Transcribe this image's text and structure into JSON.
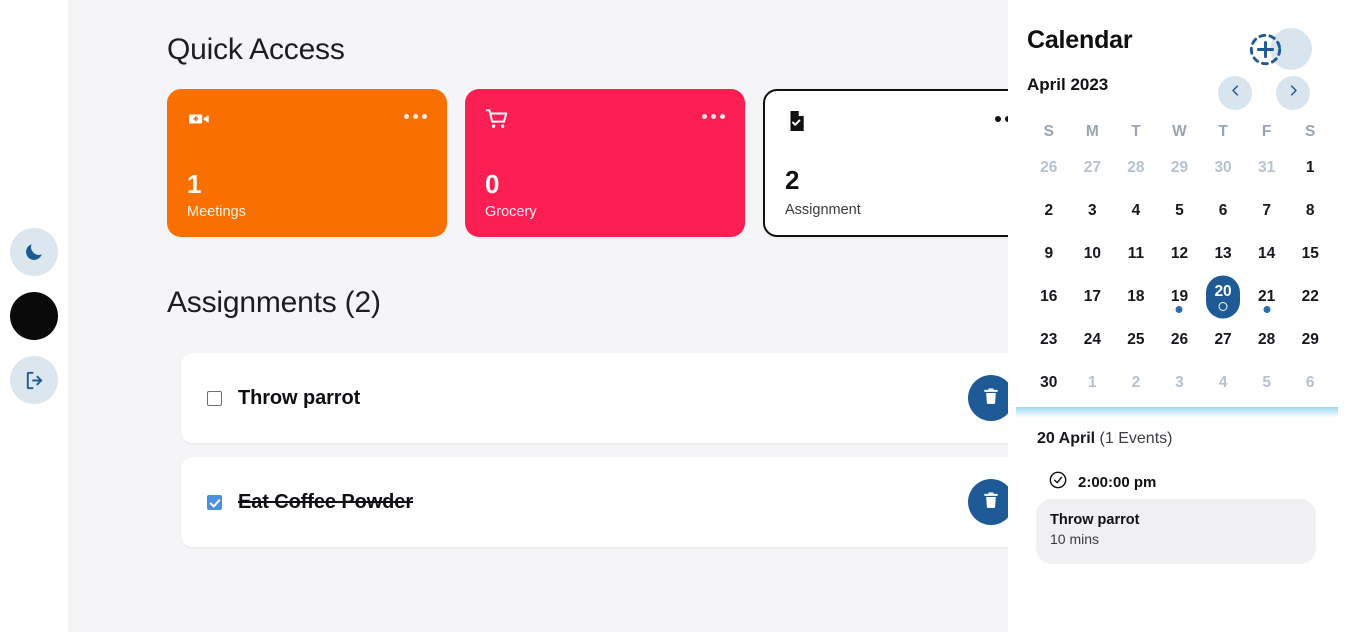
{
  "sidebar": {
    "items": [
      {
        "name": "dark-mode-toggle",
        "icon": "moon-icon"
      },
      {
        "name": "user-avatar",
        "icon": "avatar-icon"
      },
      {
        "name": "logout-button",
        "icon": "logout-icon"
      }
    ]
  },
  "main": {
    "quick_access_title": "Quick Access",
    "assignments_title": "Assignments (2)",
    "cards": [
      {
        "count": "1",
        "label": "Meetings",
        "icon": "video-camera-add-icon",
        "color": "#fa7000",
        "menu": "more-options"
      },
      {
        "count": "0",
        "label": "Grocery",
        "icon": "shopping-cart-icon",
        "color": "#fb1e52",
        "menu": "more-options"
      },
      {
        "count": "2",
        "label": "Assignment",
        "icon": "document-check-icon",
        "color": "#ffffff",
        "menu": "more-options"
      }
    ],
    "assignments": [
      {
        "title": "Throw parrot",
        "checked": false,
        "delete_icon": "trash-icon"
      },
      {
        "title": "Eat Coffee Powder",
        "checked": true,
        "delete_icon": "trash-icon"
      }
    ]
  },
  "calendar": {
    "title": "Calendar",
    "month_label": "April 2023",
    "add_event_icon": "add-circle-dashed-icon",
    "prev_icon": "chevron-left-icon",
    "next_icon": "chevron-right-icon",
    "weekdays": [
      "S",
      "M",
      "T",
      "W",
      "T",
      "F",
      "S"
    ],
    "days": [
      {
        "d": "26",
        "muted": true
      },
      {
        "d": "27",
        "muted": true
      },
      {
        "d": "28",
        "muted": true
      },
      {
        "d": "29",
        "muted": true
      },
      {
        "d": "30",
        "muted": true
      },
      {
        "d": "31",
        "muted": true
      },
      {
        "d": "1",
        "muted": false
      },
      {
        "d": "2",
        "muted": false
      },
      {
        "d": "3",
        "muted": false
      },
      {
        "d": "4",
        "muted": false
      },
      {
        "d": "5",
        "muted": false
      },
      {
        "d": "6",
        "muted": false
      },
      {
        "d": "7",
        "muted": false
      },
      {
        "d": "8",
        "muted": false
      },
      {
        "d": "9",
        "muted": false
      },
      {
        "d": "10",
        "muted": false
      },
      {
        "d": "11",
        "muted": false
      },
      {
        "d": "12",
        "muted": false
      },
      {
        "d": "13",
        "muted": false
      },
      {
        "d": "14",
        "muted": false
      },
      {
        "d": "15",
        "muted": false
      },
      {
        "d": "16",
        "muted": false
      },
      {
        "d": "17",
        "muted": false
      },
      {
        "d": "18",
        "muted": false
      },
      {
        "d": "19",
        "muted": false,
        "dot": true
      },
      {
        "d": "20",
        "muted": false,
        "dot": true,
        "selected": true
      },
      {
        "d": "21",
        "muted": false,
        "dot": true
      },
      {
        "d": "22",
        "muted": false
      },
      {
        "d": "23",
        "muted": false
      },
      {
        "d": "24",
        "muted": false
      },
      {
        "d": "25",
        "muted": false
      },
      {
        "d": "26",
        "muted": false
      },
      {
        "d": "27",
        "muted": false
      },
      {
        "d": "28",
        "muted": false
      },
      {
        "d": "29",
        "muted": false
      },
      {
        "d": "30",
        "muted": false
      },
      {
        "d": "1",
        "muted": true
      },
      {
        "d": "2",
        "muted": true
      },
      {
        "d": "3",
        "muted": true
      },
      {
        "d": "4",
        "muted": true
      },
      {
        "d": "5",
        "muted": true
      },
      {
        "d": "6",
        "muted": true
      }
    ],
    "events_header_date": "20 April",
    "events_header_count": "(1 Events)",
    "events": [
      {
        "time": "2:00:00 pm",
        "status_icon": "check-circle-icon",
        "title": "Throw parrot",
        "duration": "10 mins"
      }
    ]
  },
  "colors": {
    "accent_blue": "#1d5a96",
    "light_blue": "#d8e5ef",
    "orange": "#fa7000",
    "pink": "#fb1e52",
    "checkbox_blue": "#4a90e2",
    "page_bg": "#f5f5f7",
    "muted_day": "#b6c2ce"
  }
}
